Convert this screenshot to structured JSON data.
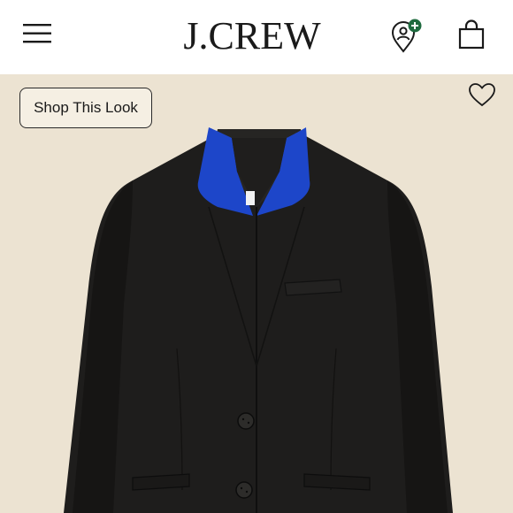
{
  "header": {
    "logo_text": "J.CREW",
    "menu_icon": "hamburger-menu-icon",
    "store_icon": "store-locator-icon",
    "bag_icon": "shopping-bag-icon"
  },
  "product": {
    "shop_look_label": "Shop This Look",
    "wishlist_icon": "heart-icon"
  },
  "colors": {
    "background": "#ece3d2",
    "accent_green": "#1f6b3f",
    "collar_blue": "#1d46c9",
    "jacket": "#1e1d1c"
  }
}
